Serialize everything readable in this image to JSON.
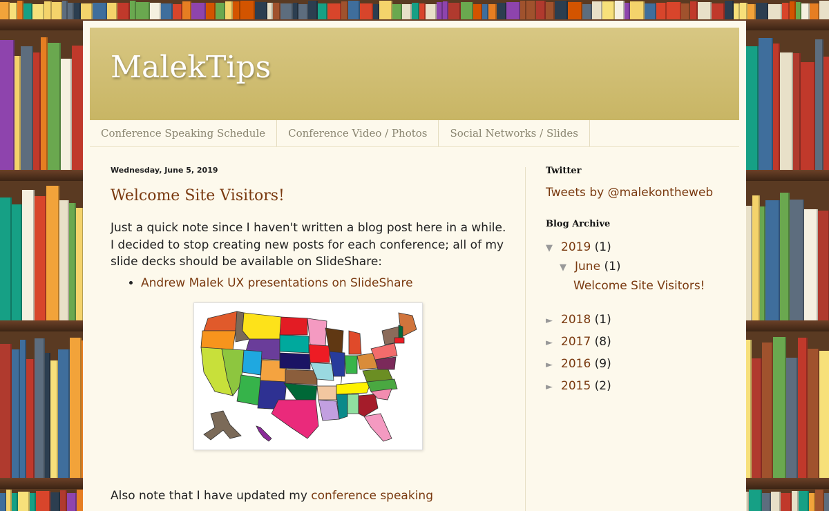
{
  "blog": {
    "title": "MalekTips"
  },
  "tabs": [
    "Conference Speaking Schedule",
    "Conference Video / Photos",
    "Social Networks / Slides"
  ],
  "post": {
    "date": "Wednesday, June 5, 2019",
    "title": "Welcome Site Visitors!",
    "intro": "Just a quick note since I haven't written a blog post here in a while. I decided to stop creating new posts for each conference; all of my slide decks should be available on SlideShare:",
    "bullet_link": "Andrew Malek UX presentations on SlideShare",
    "para2_prefix": "Also note that I have updated my ",
    "para2_link": "conference speaking"
  },
  "sidebar": {
    "twitter_title": "Twitter",
    "tweets_link": "Tweets by @malekontheweb",
    "archive_title": "Blog Archive",
    "archive": [
      {
        "label": "2019",
        "count": "(1)",
        "expanded": true
      },
      {
        "label": "June",
        "count": "(1)",
        "expanded": true
      },
      {
        "label": "Welcome Site Visitors!"
      },
      {
        "label": "2018",
        "count": "(1)"
      },
      {
        "label": "2017",
        "count": "(8)"
      },
      {
        "label": "2016",
        "count": "(9)"
      },
      {
        "label": "2015",
        "count": "(2)"
      }
    ]
  },
  "icons": {
    "expanded": "triangle-down-icon",
    "collapsed": "triangle-right-icon"
  },
  "colors": {
    "link": "#7a3a10",
    "header": "#cdbb6c",
    "page": "#fdf9ec"
  }
}
